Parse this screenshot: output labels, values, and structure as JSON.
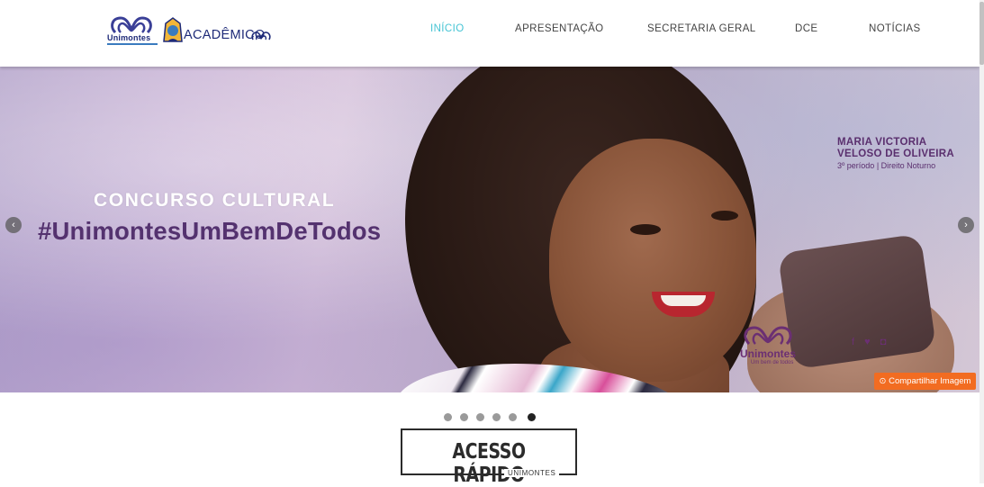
{
  "brand": {
    "unimontes_name": "Unimontes",
    "academico_name": "ACADÊMICO"
  },
  "nav": {
    "items": [
      {
        "label": "INÍCIO",
        "active": true
      },
      {
        "label": "APRESENTAÇÃO",
        "active": false
      },
      {
        "label": "SECRETARIA GERAL",
        "active": false
      },
      {
        "label": "DCE",
        "active": false
      },
      {
        "label": "NOTÍCIAS",
        "active": false
      }
    ]
  },
  "slider": {
    "headline": "CONCURSO CULTURAL",
    "hashtag": "#UnimontesUmBemDeTodos",
    "credit_name_line1": "MARIA VICTORIA",
    "credit_name_line2": "VELOSO DE OLIVEIRA",
    "credit_detail": "3º período | Direito Noturno",
    "slide_logo_text": "Unimontes",
    "slide_logo_sub": "Um bem de todos",
    "social_icons": "f ♥ ◘",
    "share_label": "Compartilhar Imagem",
    "prev_icon": "‹",
    "next_icon": "›",
    "dot_count": 6,
    "active_dot": 6
  },
  "section": {
    "title": "ACESSO RÁPIDO",
    "subtitle": "UNIMONTES"
  },
  "colors": {
    "nav_active": "#45c4d4",
    "share_button": "#f26c21",
    "hashtag": "#54326f"
  }
}
